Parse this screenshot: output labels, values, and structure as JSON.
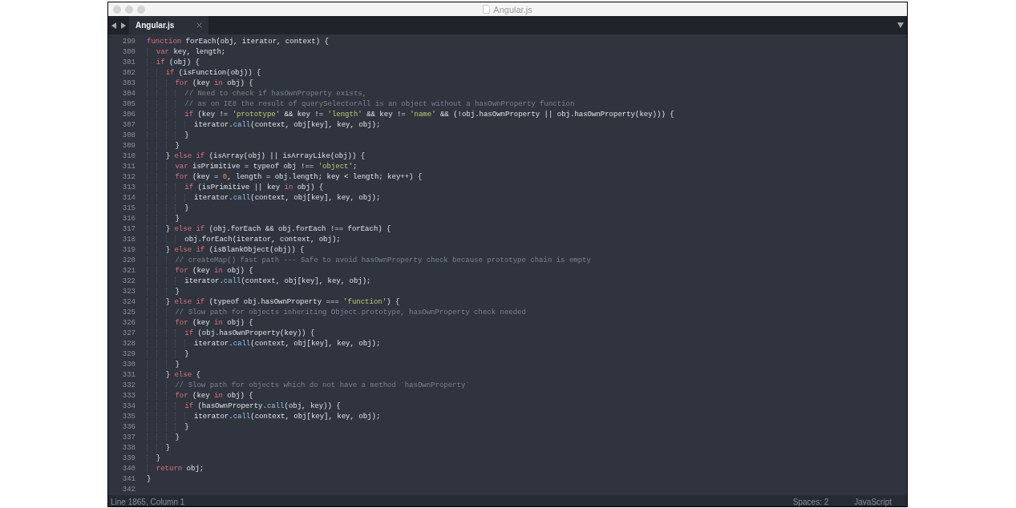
{
  "window": {
    "title": "Angular.js"
  },
  "tab_bar": {
    "tabs": [
      {
        "label": "Angular.js",
        "selected": true
      }
    ]
  },
  "editor": {
    "lines": [
      {
        "number": "299",
        "segments": [
          {
            "kind": "keyword",
            "text": "function"
          },
          {
            "kind": "plain",
            "text": " forEach(obj, iterator, context) {"
          }
        ]
      },
      {
        "number": "300",
        "segments": [
          {
            "kind": "keyword",
            "text": "  var"
          },
          {
            "kind": "plain",
            "text": " key, length;"
          }
        ]
      },
      {
        "number": "301",
        "segments": [
          {
            "kind": "keyword",
            "text": "  if"
          },
          {
            "kind": "plain",
            "text": " (obj) {"
          }
        ]
      },
      {
        "number": "302",
        "segments": [
          {
            "kind": "keyword",
            "text": "    if"
          },
          {
            "kind": "plain",
            "text": " (isFunction(obj)) {"
          }
        ]
      },
      {
        "number": "303",
        "segments": [
          {
            "kind": "keyword",
            "text": "      for"
          },
          {
            "kind": "plain",
            "text": " (key "
          },
          {
            "kind": "keyword",
            "text": "in"
          },
          {
            "kind": "plain",
            "text": " obj) {"
          }
        ]
      },
      {
        "number": "304",
        "segments": [
          {
            "kind": "comment",
            "text": "        // Need to check if hasOwnProperty exists,"
          }
        ]
      },
      {
        "number": "305",
        "segments": [
          {
            "kind": "comment",
            "text": "        // as on IE8 the result of querySelectorAll is an object without a hasOwnProperty function"
          }
        ]
      },
      {
        "number": "306",
        "segments": [
          {
            "kind": "keyword",
            "text": "        if"
          },
          {
            "kind": "plain",
            "text": " (key != "
          },
          {
            "kind": "string",
            "text": "'prototype'"
          },
          {
            "kind": "plain",
            "text": " && key != "
          },
          {
            "kind": "string",
            "text": "'length'"
          },
          {
            "kind": "plain",
            "text": " && key != "
          },
          {
            "kind": "string",
            "text": "'name'"
          },
          {
            "kind": "plain",
            "text": " && (!obj.hasOwnProperty || obj.hasOwnProperty(key))) {"
          }
        ]
      },
      {
        "number": "307",
        "segments": [
          {
            "kind": "plain",
            "text": "          iterator."
          },
          {
            "kind": "method",
            "text": "call"
          },
          {
            "kind": "plain",
            "text": "(context, obj[key], key, obj);"
          }
        ]
      },
      {
        "number": "308",
        "segments": [
          {
            "kind": "plain",
            "text": "        }"
          }
        ]
      },
      {
        "number": "309",
        "segments": [
          {
            "kind": "plain",
            "text": "      }"
          }
        ]
      },
      {
        "number": "310",
        "segments": [
          {
            "kind": "plain",
            "text": "    } "
          },
          {
            "kind": "keyword",
            "text": "else if"
          },
          {
            "kind": "plain",
            "text": " (isArray(obj) || isArrayLike(obj)) {"
          }
        ]
      },
      {
        "number": "311",
        "segments": [
          {
            "kind": "keyword",
            "text": "      var"
          },
          {
            "kind": "plain",
            "text": " isPrimitive = typeof obj !== "
          },
          {
            "kind": "string",
            "text": "'object'"
          },
          {
            "kind": "plain",
            "text": ";"
          }
        ]
      },
      {
        "number": "312",
        "segments": [
          {
            "kind": "keyword",
            "text": "      for"
          },
          {
            "kind": "plain",
            "text": " (key = "
          },
          {
            "kind": "number",
            "text": "0"
          },
          {
            "kind": "plain",
            "text": ", length = obj.length; key < length; key++) {"
          }
        ]
      },
      {
        "number": "313",
        "segments": [
          {
            "kind": "keyword",
            "text": "        if"
          },
          {
            "kind": "plain",
            "text": " (isPrimitive || key "
          },
          {
            "kind": "keyword",
            "text": "in"
          },
          {
            "kind": "plain",
            "text": " obj) {"
          }
        ]
      },
      {
        "number": "314",
        "segments": [
          {
            "kind": "plain",
            "text": "          iterator."
          },
          {
            "kind": "method",
            "text": "call"
          },
          {
            "kind": "plain",
            "text": "(context, obj[key], key, obj);"
          }
        ]
      },
      {
        "number": "315",
        "segments": [
          {
            "kind": "plain",
            "text": "        }"
          }
        ]
      },
      {
        "number": "316",
        "segments": [
          {
            "kind": "plain",
            "text": "      }"
          }
        ]
      },
      {
        "number": "317",
        "segments": [
          {
            "kind": "plain",
            "text": "    } "
          },
          {
            "kind": "keyword",
            "text": "else if"
          },
          {
            "kind": "plain",
            "text": " (obj.forEach && obj.forEach !== forEach) {"
          }
        ]
      },
      {
        "number": "318",
        "segments": [
          {
            "kind": "plain",
            "text": "        obj.forEach(iterator, context, obj);"
          }
        ]
      },
      {
        "number": "319",
        "segments": [
          {
            "kind": "plain",
            "text": "    } "
          },
          {
            "kind": "keyword",
            "text": "else if"
          },
          {
            "kind": "plain",
            "text": " (isBlankObject(obj)) {"
          }
        ]
      },
      {
        "number": "320",
        "segments": [
          {
            "kind": "comment",
            "text": "      // createMap() fast path --- Safe to avoid hasOwnProperty check because prototype chain is empty"
          }
        ]
      },
      {
        "number": "321",
        "segments": [
          {
            "kind": "keyword",
            "text": "      for"
          },
          {
            "kind": "plain",
            "text": " (key "
          },
          {
            "kind": "keyword",
            "text": "in"
          },
          {
            "kind": "plain",
            "text": " obj) {"
          }
        ]
      },
      {
        "number": "322",
        "segments": [
          {
            "kind": "plain",
            "text": "        iterator."
          },
          {
            "kind": "method",
            "text": "call"
          },
          {
            "kind": "plain",
            "text": "(context, obj[key], key, obj);"
          }
        ]
      },
      {
        "number": "323",
        "segments": [
          {
            "kind": "plain",
            "text": "      }"
          }
        ]
      },
      {
        "number": "324",
        "segments": [
          {
            "kind": "plain",
            "text": "    } "
          },
          {
            "kind": "keyword",
            "text": "else if"
          },
          {
            "kind": "plain",
            "text": " (typeof obj.hasOwnProperty === "
          },
          {
            "kind": "string",
            "text": "'function'"
          },
          {
            "kind": "plain",
            "text": ") {"
          }
        ]
      },
      {
        "number": "325",
        "segments": [
          {
            "kind": "comment",
            "text": "      // Slow path for objects inheriting Object.prototype, hasOwnProperty check needed"
          }
        ]
      },
      {
        "number": "326",
        "segments": [
          {
            "kind": "keyword",
            "text": "      for"
          },
          {
            "kind": "plain",
            "text": " (key "
          },
          {
            "kind": "keyword",
            "text": "in"
          },
          {
            "kind": "plain",
            "text": " obj) {"
          }
        ]
      },
      {
        "number": "327",
        "segments": [
          {
            "kind": "keyword",
            "text": "        if"
          },
          {
            "kind": "plain",
            "text": " (obj.hasOwnProperty(key)) {"
          }
        ]
      },
      {
        "number": "328",
        "segments": [
          {
            "kind": "plain",
            "text": "          iterator."
          },
          {
            "kind": "method",
            "text": "call"
          },
          {
            "kind": "plain",
            "text": "(context, obj[key], key, obj);"
          }
        ]
      },
      {
        "number": "329",
        "segments": [
          {
            "kind": "plain",
            "text": "        }"
          }
        ]
      },
      {
        "number": "330",
        "segments": [
          {
            "kind": "plain",
            "text": "      }"
          }
        ]
      },
      {
        "number": "331",
        "segments": [
          {
            "kind": "plain",
            "text": "    } "
          },
          {
            "kind": "keyword",
            "text": "else"
          },
          {
            "kind": "plain",
            "text": " {"
          }
        ]
      },
      {
        "number": "332",
        "segments": [
          {
            "kind": "comment",
            "text": "      // Slow path for objects which do not have a method `hasOwnProperty`"
          }
        ]
      },
      {
        "number": "333",
        "segments": [
          {
            "kind": "keyword",
            "text": "      for"
          },
          {
            "kind": "plain",
            "text": " (key "
          },
          {
            "kind": "keyword",
            "text": "in"
          },
          {
            "kind": "plain",
            "text": " obj) {"
          }
        ]
      },
      {
        "number": "334",
        "segments": [
          {
            "kind": "keyword",
            "text": "        if"
          },
          {
            "kind": "plain",
            "text": " (hasOwnProperty."
          },
          {
            "kind": "method",
            "text": "call"
          },
          {
            "kind": "plain",
            "text": "(obj, key)) {"
          }
        ]
      },
      {
        "number": "335",
        "segments": [
          {
            "kind": "plain",
            "text": "          iterator."
          },
          {
            "kind": "method",
            "text": "call"
          },
          {
            "kind": "plain",
            "text": "(context, obj[key], key, obj);"
          }
        ]
      },
      {
        "number": "336",
        "segments": [
          {
            "kind": "plain",
            "text": "        }"
          }
        ]
      },
      {
        "number": "337",
        "segments": [
          {
            "kind": "plain",
            "text": "      }"
          }
        ]
      },
      {
        "number": "338",
        "segments": [
          {
            "kind": "plain",
            "text": "    }"
          }
        ]
      },
      {
        "number": "339",
        "segments": [
          {
            "kind": "plain",
            "text": "  }"
          }
        ]
      },
      {
        "number": "340",
        "segments": [
          {
            "kind": "keyword",
            "text": "  return"
          },
          {
            "kind": "plain",
            "text": " obj;"
          }
        ]
      },
      {
        "number": "341",
        "segments": [
          {
            "kind": "plain",
            "text": "}"
          }
        ]
      },
      {
        "number": "342"
      }
    ]
  },
  "status_bar": {
    "position": "Line 1865, Column 1",
    "indentation": "Spaces: 2",
    "syntax": "JavaScript"
  }
}
